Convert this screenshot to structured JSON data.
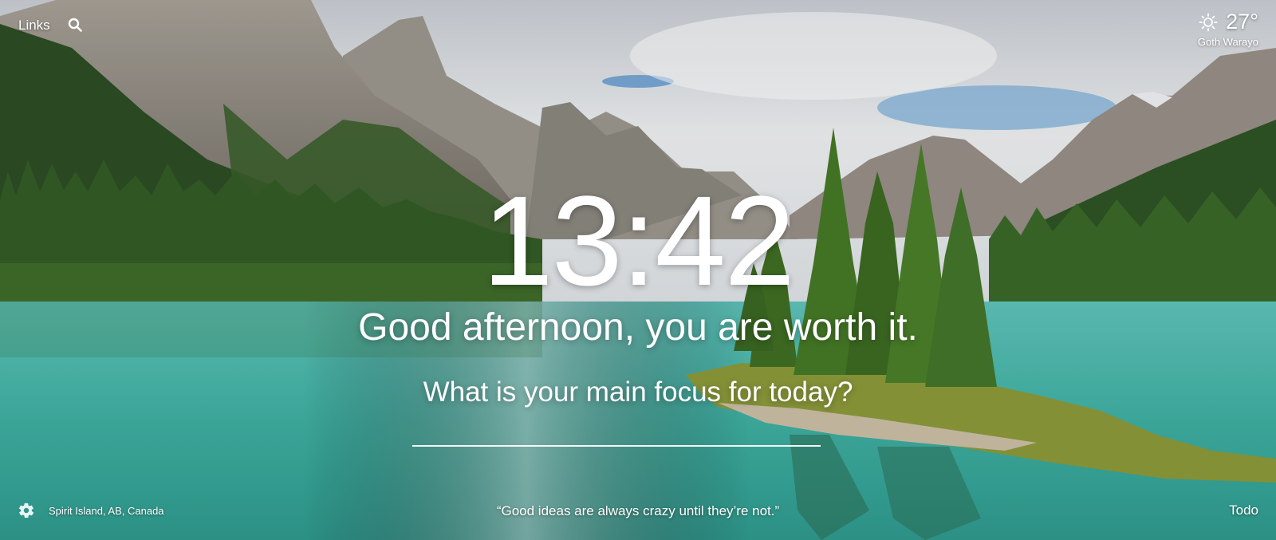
{
  "header": {
    "links_label": "Links",
    "search_icon": "search-icon"
  },
  "weather": {
    "icon": "sun-icon",
    "temperature": "27°",
    "location": "Goth Warayo"
  },
  "main": {
    "time": "13:42",
    "greeting": "Good afternoon, you are worth it.",
    "focus_question": "What is your main focus for today?",
    "focus_value": ""
  },
  "footer": {
    "settings_icon": "gear-icon",
    "photo_location": "Spirit Island, AB, Canada",
    "quote": "“Good ideas are always crazy until they’re not.”",
    "todo_label": "Todo"
  },
  "colors": {
    "sky": "#d9dde2",
    "lake": "#3fb3a6",
    "forest": "#2f5a26",
    "mountain": "#8f8a80"
  }
}
